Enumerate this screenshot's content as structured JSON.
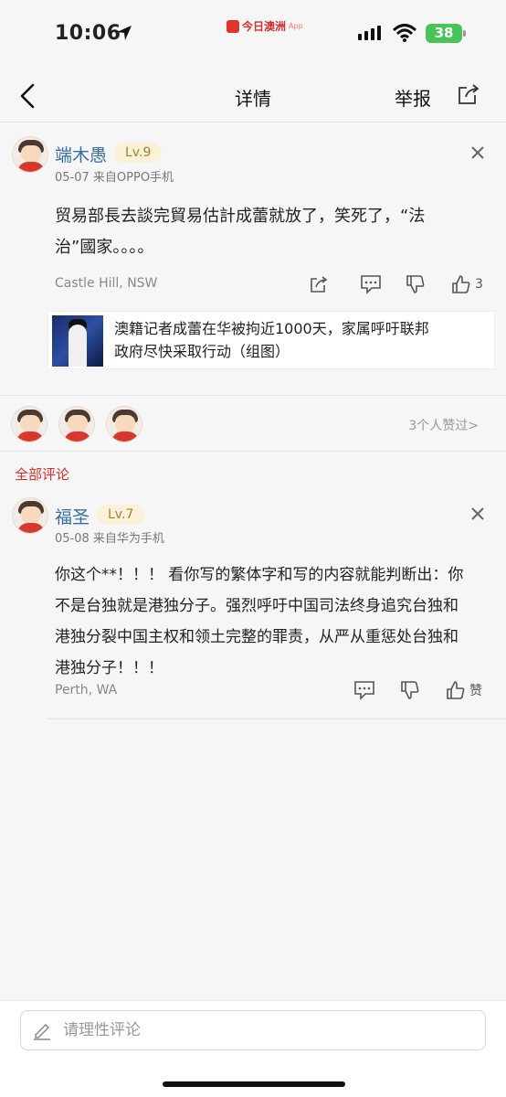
{
  "status_bar": {
    "time": "10:06",
    "app_name": "今日澳洲",
    "app_suffix": "App",
    "battery": "38"
  },
  "nav": {
    "title": "详情",
    "report": "举报"
  },
  "main_comment": {
    "username": "端木愚",
    "level": "Lv.9",
    "meta": "05-07  来自OPPO手机",
    "text_line1": "贸易部長去談完貿易估計成蕾就放了，笑死了，“法",
    "text_line2": "治”國家。。。。",
    "location": "Castle Hill, NSW",
    "like_count": "3"
  },
  "article": {
    "line1": "澳籍记者成蕾在华被拘近1000天，家属呼吁联邦",
    "line2": "政府尽快采取行动（组图）"
  },
  "likers": {
    "link": "3个人赞过>"
  },
  "section_title": "全部评论",
  "reply": {
    "username": "福圣",
    "level": "Lv.7",
    "meta": "05-08  来自华为手机",
    "text_line1": "你这个**！！！ 看你写的繁体字和写的内容就能判断出：你",
    "text_line2": "不是台独就是港独分子。强烈呼吁中国司法终身追究台独和",
    "text_line3": "港独分裂中国主权和领土完整的罪责，从严从重惩处台独和",
    "text_line4": "港独分子！！！",
    "location": "Perth, WA",
    "like_label": "赞"
  },
  "comment_box": {
    "placeholder": "请理性评论"
  },
  "colors": {
    "accent_red": "#d6302b",
    "username_blue": "#3a6ea8",
    "battery_green": "#47c45a"
  }
}
